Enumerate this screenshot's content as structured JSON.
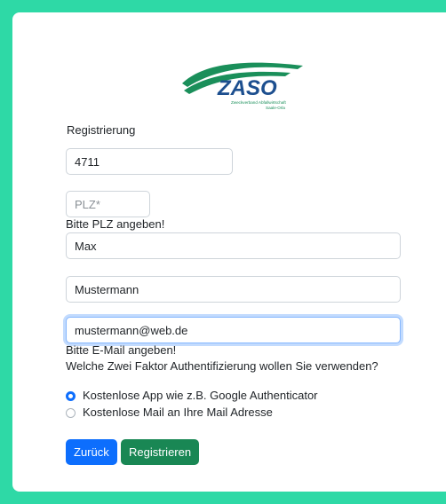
{
  "logo": {
    "name": "ZASO",
    "tagline_1": "Zweckverband Abfallwirtschaft",
    "tagline_2": "Saale-Orla"
  },
  "form": {
    "heading": "Registrierung",
    "customer_number": {
      "value": "4711"
    },
    "plz": {
      "value": "",
      "placeholder": "PLZ*",
      "error": "Bitte PLZ angeben!"
    },
    "first_name": {
      "value": "Max"
    },
    "last_name": {
      "value": "Mustermann"
    },
    "email": {
      "value": "mustermann@web.de",
      "error": "Bitte E-Mail angeben!"
    },
    "twofa_question": "Welche Zwei Faktor Authentifizierung wollen Sie verwenden?",
    "twofa_options": [
      {
        "label": "Kostenlose App wie z.B. Google Authenticator",
        "checked": true
      },
      {
        "label": "Kostenlose Mail an Ihre Mail Adresse",
        "checked": false
      }
    ]
  },
  "buttons": {
    "back": "Zurück",
    "register": "Registrieren"
  },
  "colors": {
    "background": "#2ed9a6",
    "logo_green": "#1a8f5a",
    "logo_blue": "#1d4f8f",
    "primary": "#0d6efd",
    "success": "#198754"
  }
}
